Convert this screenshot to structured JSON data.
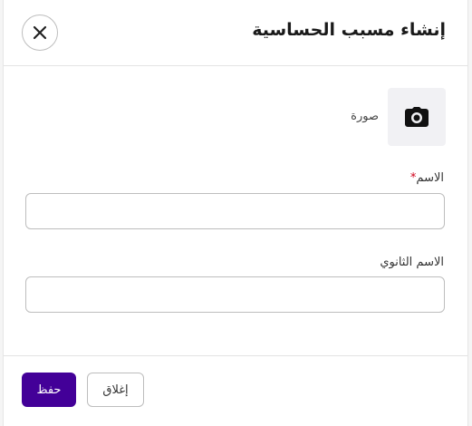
{
  "dialog": {
    "title": "إنشاء مسبب الحساسية",
    "close_icon": "close-icon"
  },
  "photo": {
    "label": "صورة",
    "icon": "camera-icon"
  },
  "fields": {
    "name": {
      "label": "الاسم",
      "required_mark": "*",
      "value": ""
    },
    "secondary_name": {
      "label": "الاسم الثانوي",
      "value": ""
    }
  },
  "footer": {
    "save_label": "حفظ",
    "cancel_label": "إغلاق"
  },
  "colors": {
    "primary": "#430098",
    "required": "#d0021b"
  }
}
